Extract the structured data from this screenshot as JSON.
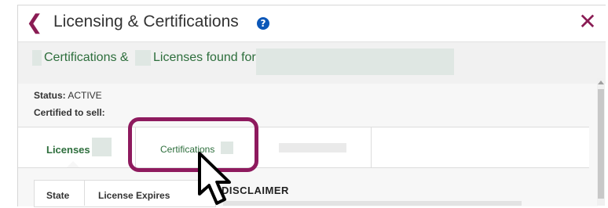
{
  "header": {
    "back_glyph": "❮",
    "title": "Licensing & Certifications",
    "help_glyph": "?",
    "close_glyph": "✕"
  },
  "found_bar": {
    "text_part1": "Certifications &",
    "text_part2": "Licenses found for"
  },
  "status": {
    "label": "Status:",
    "value": "ACTIVE",
    "certified_label": "Certified to sell:"
  },
  "tabs": [
    {
      "label": "Licenses",
      "active": true
    },
    {
      "label": "Certifications",
      "active": false
    }
  ],
  "table": {
    "columns": [
      "State",
      "License Expires"
    ]
  },
  "disclaimer": {
    "heading": "DISCLAIMER"
  },
  "colors": {
    "accent": "#8a1c54",
    "brand_green": "#2d6e3c",
    "help_blue": "#0b57b8",
    "highlight": "#8e1a5e"
  },
  "icons": {
    "back": "chevron-left-icon",
    "help": "help-icon",
    "close": "close-icon",
    "cursor": "mouse-pointer-icon"
  }
}
